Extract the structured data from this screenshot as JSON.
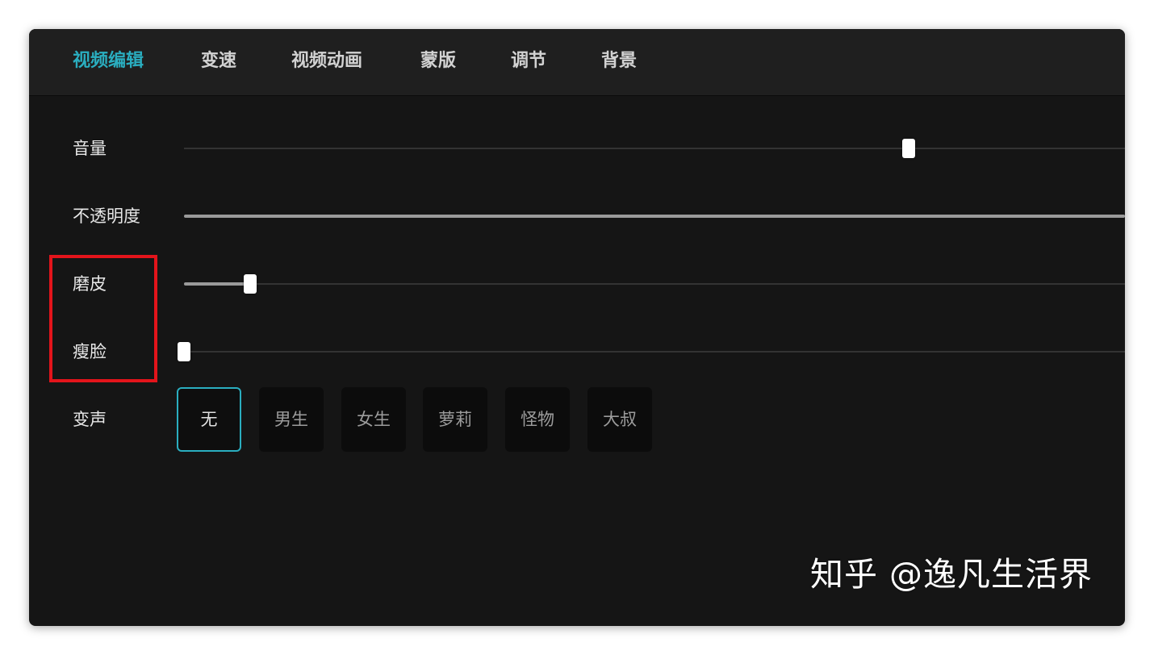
{
  "tabs": [
    {
      "label": "视频编辑",
      "active": true
    },
    {
      "label": "变速",
      "active": false
    },
    {
      "label": "视频动画",
      "active": false
    },
    {
      "label": "蒙版",
      "active": false
    },
    {
      "label": "调节",
      "active": false
    },
    {
      "label": "背景",
      "active": false
    }
  ],
  "settings": {
    "volume": {
      "label": "音量",
      "value_fraction": 0.77
    },
    "opacity": {
      "label": "不透明度",
      "value_fraction": 1.0
    },
    "smoothing": {
      "label": "磨皮",
      "value_fraction": 0.07
    },
    "slim_face": {
      "label": "瘦脸",
      "value_fraction": 0.0
    },
    "voice_change": {
      "label": "变声",
      "selected": "无",
      "options": [
        "无",
        "男生",
        "女生",
        "萝莉",
        "怪物",
        "大叔"
      ]
    }
  },
  "watermark": "知乎 @逸凡生活界",
  "colors": {
    "accent": "#2aaec0",
    "highlight": "#e3141b",
    "panel_bg": "#151515",
    "tabbar_bg": "#1f1f1f"
  }
}
